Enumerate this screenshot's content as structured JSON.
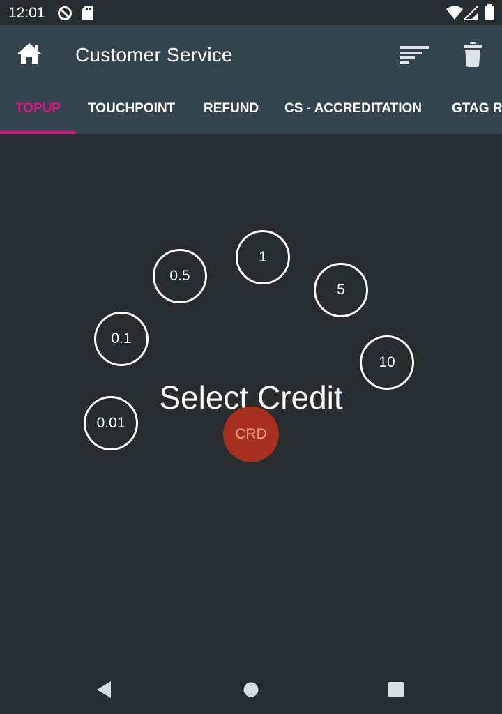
{
  "status_bar": {
    "time": "12:01",
    "icons": [
      "no-sync-icon",
      "sd-card-icon",
      "wifi-icon",
      "signal-icon",
      "battery-icon"
    ]
  },
  "app_bar": {
    "title": "Customer Service",
    "left_icon": "home-icon",
    "right_icons": [
      "sort-icon",
      "trash-icon"
    ],
    "background": "#34444f"
  },
  "tabs": {
    "items": [
      {
        "label": "TOPUP",
        "active": true
      },
      {
        "label": "TOUCHPOINT",
        "active": false
      },
      {
        "label": "REFUND",
        "active": false
      },
      {
        "label": "CS - ACCREDITATION",
        "active": false
      },
      {
        "label": "GTAG R",
        "active": false
      }
    ],
    "active_color": "#e0127d"
  },
  "credit_selector": {
    "title": "Select Credit",
    "options": [
      "0.01",
      "0.1",
      "0.5",
      "1",
      "5",
      "10"
    ],
    "center_button": "CRD",
    "center_color": "#a8301f"
  },
  "nav_bar": {
    "icons": [
      "back-icon",
      "home-circle-icon",
      "recents-icon"
    ]
  },
  "colors": {
    "background": "#252d33",
    "accent": "#e0127d"
  }
}
